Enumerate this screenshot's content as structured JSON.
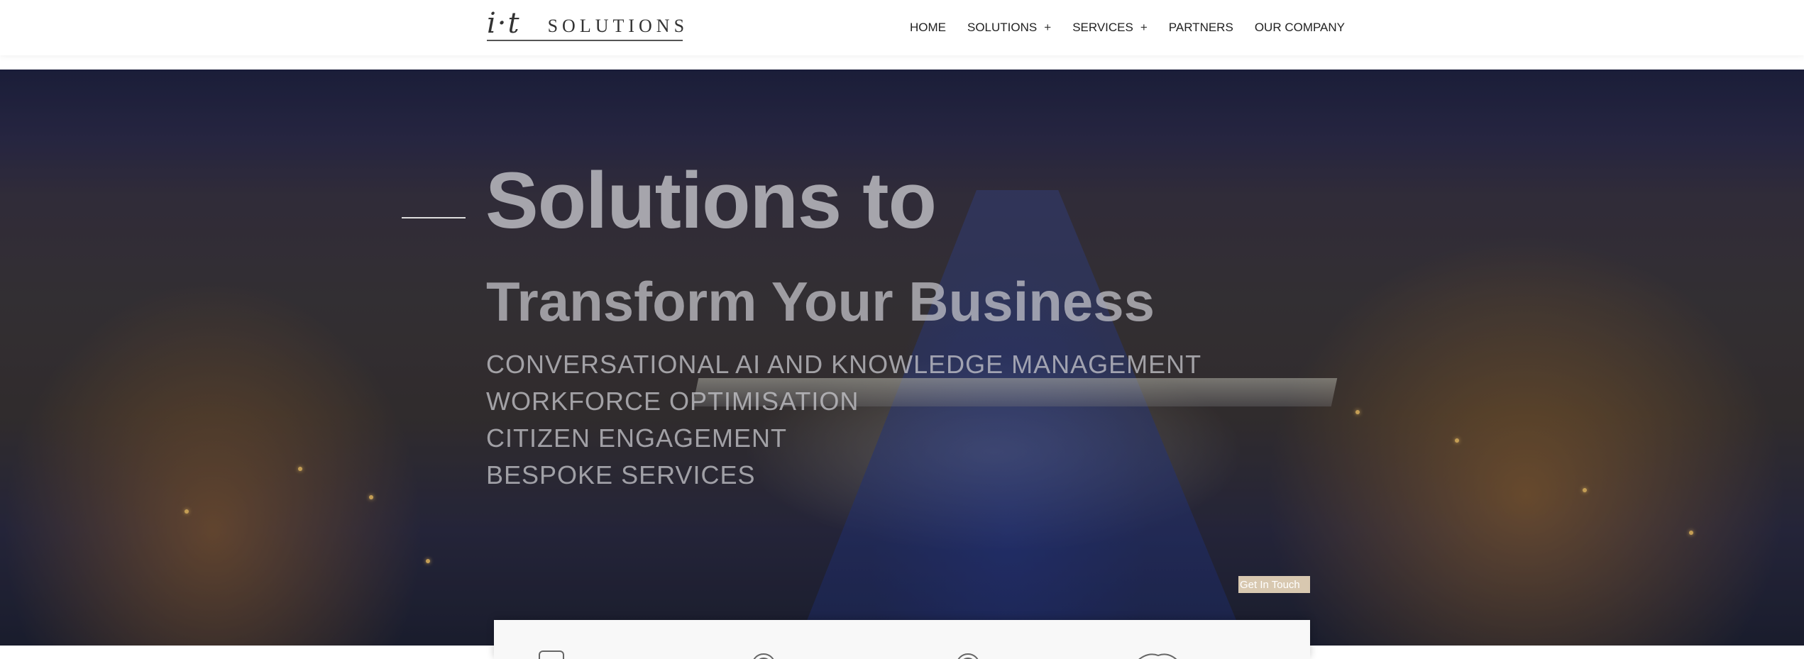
{
  "header": {
    "logo": {
      "mark": "i·t",
      "text": "SOLUTIONS"
    },
    "nav": [
      {
        "label": "HOME",
        "has_submenu": false
      },
      {
        "label": "SOLUTIONS",
        "has_submenu": true,
        "submenu_icon": "+"
      },
      {
        "label": "SERVICES",
        "has_submenu": true,
        "submenu_icon": "+"
      },
      {
        "label": "PARTNERS",
        "has_submenu": false
      },
      {
        "label": "OUR COMPANY",
        "has_submenu": false
      }
    ]
  },
  "hero": {
    "title": "Solutions to",
    "subtitle": "Transform Your Business",
    "list": [
      "CONVERSATIONAL AI AND KNOWLEDGE MANAGEMENT",
      "WORKFORCE OPTIMISATION",
      "CITIZEN ENGAGEMENT",
      "BESPOKE SERVICES"
    ],
    "cta_label": "Get In Touch",
    "background": "night-city-river-photo"
  },
  "features": {
    "icons": [
      "device-icon",
      "target-icon",
      "target-icon",
      "handshake-icon"
    ]
  },
  "colors": {
    "header_bg": "#ffffff",
    "nav_text": "#222222",
    "hero_text": "#c8c8cd",
    "cta_bg": "#d8c8b0",
    "panel_bg": "#f8f8f8"
  }
}
